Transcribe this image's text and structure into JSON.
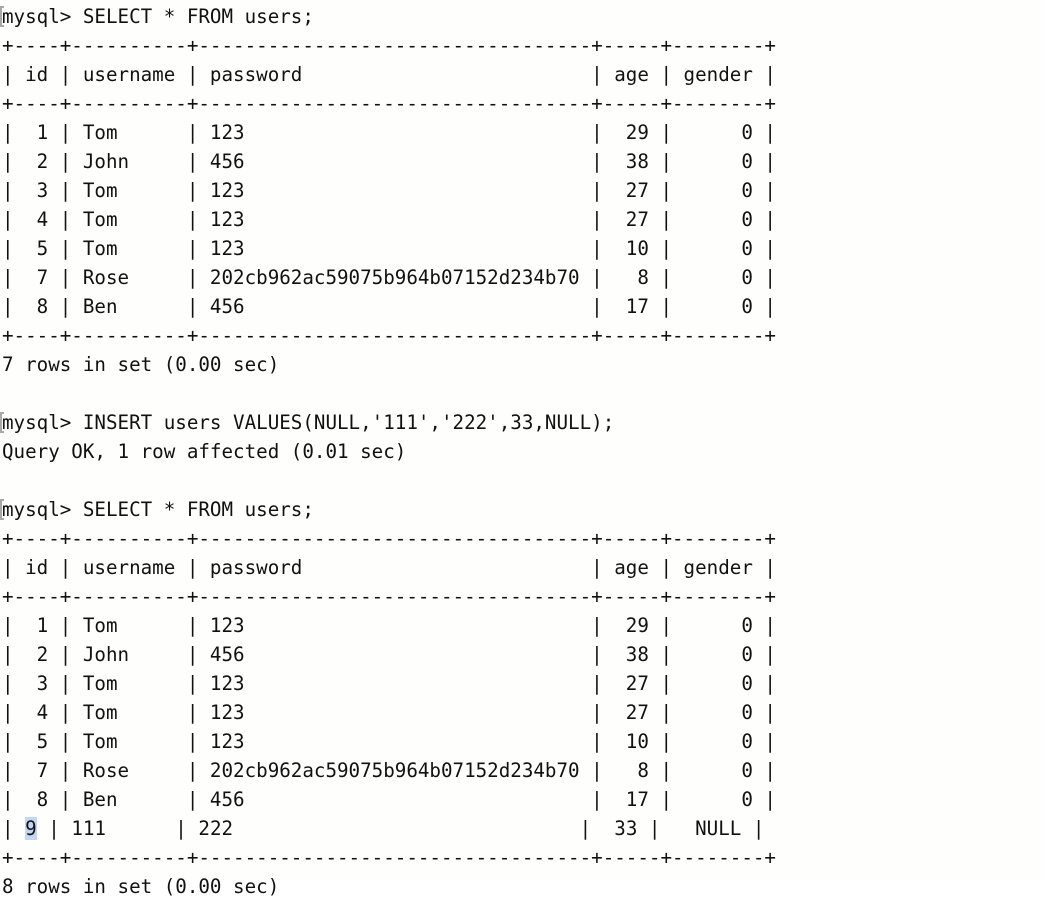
{
  "terminal": {
    "app": "mysql-client-terminal",
    "background_color": "#fefefc",
    "text_color": "#111111",
    "selection_color": "#c3d7f2",
    "prompt": "mysql> "
  },
  "session": {
    "line_01_command": "mysql> SELECT * FROM users;",
    "line_02_rule_top": "+----+----------+----------------------------------+-----+--------+",
    "line_03_header": "| id | username | password                         | age | gender |",
    "line_04_rule_mid": "+----+----------+----------------------------------+-----+--------+",
    "line_05_row1": "|  1 | Tom      | 123                              |  29 |      0 |",
    "line_06_row2": "|  2 | John     | 456                              |  38 |      0 |",
    "line_07_row3": "|  3 | Tom      | 123                              |  27 |      0 |",
    "line_08_row4": "|  4 | Tom      | 123                              |  27 |      0 |",
    "line_09_row5": "|  5 | Tom      | 123                              |  10 |      0 |",
    "line_10_row7": "|  7 | Rose     | 202cb962ac59075b964b07152d234b70 |   8 |      0 |",
    "line_11_row8": "|  8 | Ben      | 456                              |  17 |      0 |",
    "line_12_rule_bottom": "+----+----------+----------------------------------+-----+--------+",
    "line_13_result": "7 rows in set (0.00 sec)",
    "line_14_blank": "",
    "line_15_command": "mysql> INSERT users VALUES(NULL,'111','222',33,NULL);",
    "line_16_result": "Query OK, 1 row affected (0.01 sec)",
    "line_17_blank": "",
    "line_18_command": "mysql> SELECT * FROM users;",
    "line_19_rule_top": "+----+----------+----------------------------------+-----+--------+",
    "line_20_header": "| id | username | password                         | age | gender |",
    "line_21_rule_mid": "+----+----------+----------------------------------+-----+--------+",
    "line_22_row1": "|  1 | Tom      | 123                              |  29 |      0 |",
    "line_23_row2": "|  2 | John     | 456                              |  38 |      0 |",
    "line_24_row3": "|  3 | Tom      | 123                              |  27 |      0 |",
    "line_25_row4": "|  4 | Tom      | 123                              |  27 |      0 |",
    "line_26_row5": "|  5 | Tom      | 123                              |  10 |      0 |",
    "line_27_row7": "|  7 | Rose     | 202cb962ac59075b964b07152d234b70 |   8 |      0 |",
    "line_28_row8": "|  8 | Ben      | 456                              |  17 |      0 |",
    "line_29_row9_prefix": "| ",
    "line_29_row9_selected": "9",
    "line_29_row9_suffix": " | 111      | 222                              |  33 |   NULL |",
    "line_30_rule_bottom": "+----+----------+----------------------------------+-----+--------+",
    "line_31_result": "8 rows in set (0.00 sec)"
  },
  "queries": {
    "first_select": "SELECT * FROM users;",
    "insert": "INSERT users VALUES(NULL,'111','222',33,NULL);",
    "second_select": "SELECT * FROM users;"
  },
  "table_before": {
    "name": "users",
    "columns": [
      "id",
      "username",
      "password",
      "age",
      "gender"
    ],
    "rows": [
      {
        "id": "1",
        "username": "Tom",
        "password": "123",
        "age": "29",
        "gender": "0"
      },
      {
        "id": "2",
        "username": "John",
        "password": "456",
        "age": "38",
        "gender": "0"
      },
      {
        "id": "3",
        "username": "Tom",
        "password": "123",
        "age": "27",
        "gender": "0"
      },
      {
        "id": "4",
        "username": "Tom",
        "password": "123",
        "age": "27",
        "gender": "0"
      },
      {
        "id": "5",
        "username": "Tom",
        "password": "123",
        "age": "10",
        "gender": "0"
      },
      {
        "id": "7",
        "username": "Rose",
        "password": "202cb962ac59075b964b07152d234b70",
        "age": "8",
        "gender": "0"
      },
      {
        "id": "8",
        "username": "Ben",
        "password": "456",
        "age": "17",
        "gender": "0"
      }
    ],
    "row_count_text": "7 rows in set (0.00 sec)"
  },
  "insert_result": "Query OK, 1 row affected (0.01 sec)",
  "table_after": {
    "name": "users",
    "columns": [
      "id",
      "username",
      "password",
      "age",
      "gender"
    ],
    "rows": [
      {
        "id": "1",
        "username": "Tom",
        "password": "123",
        "age": "29",
        "gender": "0"
      },
      {
        "id": "2",
        "username": "John",
        "password": "456",
        "age": "38",
        "gender": "0"
      },
      {
        "id": "3",
        "username": "Tom",
        "password": "123",
        "age": "27",
        "gender": "0"
      },
      {
        "id": "4",
        "username": "Tom",
        "password": "123",
        "age": "27",
        "gender": "0"
      },
      {
        "id": "5",
        "username": "Tom",
        "password": "123",
        "age": "10",
        "gender": "0"
      },
      {
        "id": "7",
        "username": "Rose",
        "password": "202cb962ac59075b964b07152d234b70",
        "age": "8",
        "gender": "0"
      },
      {
        "id": "8",
        "username": "Ben",
        "password": "456",
        "age": "17",
        "gender": "0"
      },
      {
        "id": "9",
        "username": "111",
        "password": "222",
        "age": "33",
        "gender": "NULL"
      }
    ],
    "row_count_text": "8 rows in set (0.00 sec)",
    "selected_cell": "9"
  }
}
